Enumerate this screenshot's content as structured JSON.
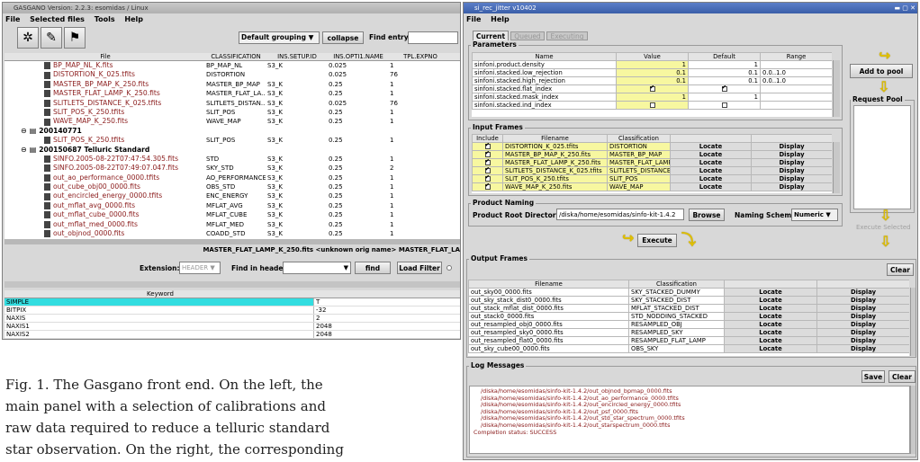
{
  "left": {
    "title": "GASGANO Version: 2.2.3: esomidas / Linux",
    "menu": [
      "File",
      "Selected files",
      "Tools",
      "Help"
    ],
    "grouping_value": "Default grouping",
    "collapse_label": "collapse",
    "find_entry_label": "Find entry:",
    "columns": [
      "File",
      "CLASSIFICATION",
      "INS.SETUP.ID",
      "INS.OPTI1.NAME",
      "TPL.EXPNO"
    ],
    "files": [
      {
        "name": "BP_MAP_NL_K.fits",
        "cls": "BP_MAP_NL",
        "setup": "S3_K",
        "opti": "0.025",
        "expno": "1",
        "kind": "red",
        "indent": 1
      },
      {
        "name": "DISTORTION_K_025.tfits",
        "cls": "DISTORTION",
        "setup": "",
        "opti": "0.025",
        "expno": "76",
        "kind": "red",
        "indent": 1
      },
      {
        "name": "MASTER_BP_MAP_K_250.fits",
        "cls": "MASTER_BP_MAP",
        "setup": "S3_K",
        "opti": "0.25",
        "expno": "1",
        "kind": "red",
        "indent": 1
      },
      {
        "name": "MASTER_FLAT_LAMP_K_250.fits",
        "cls": "MASTER_FLAT_LA...",
        "setup": "S3_K",
        "opti": "0.25",
        "expno": "1",
        "kind": "red",
        "indent": 1
      },
      {
        "name": "SLITLETS_DISTANCE_K_025.tfits",
        "cls": "SLITLETS_DISTAN...",
        "setup": "S3_K",
        "opti": "0.025",
        "expno": "76",
        "kind": "red",
        "indent": 1
      },
      {
        "name": "SLIT_POS_K_250.tfits",
        "cls": "SLIT_POS",
        "setup": "S3_K",
        "opti": "0.25",
        "expno": "1",
        "kind": "red",
        "indent": 1
      },
      {
        "name": "WAVE_MAP_K_250.fits",
        "cls": "WAVE_MAP",
        "setup": "S3_K",
        "opti": "0.25",
        "expno": "1",
        "kind": "red",
        "indent": 1
      },
      {
        "name": "200140771",
        "cls": "",
        "setup": "",
        "opti": "",
        "expno": "",
        "kind": "group",
        "indent": 0
      },
      {
        "name": "SLIT_POS_K_250.tfits",
        "cls": "SLIT_POS",
        "setup": "S3_K",
        "opti": "0.25",
        "expno": "1",
        "kind": "red",
        "indent": 1
      },
      {
        "name": "200150687    Telluric Standard",
        "cls": "",
        "setup": "",
        "opti": "",
        "expno": "",
        "kind": "group",
        "indent": 0
      },
      {
        "name": "SINFO.2005-08-22T07:47:54.305.fits",
        "cls": "STD",
        "setup": "S3_K",
        "opti": "0.25",
        "expno": "1",
        "kind": "red",
        "indent": 1
      },
      {
        "name": "SINFO.2005-08-22T07:49:07.047.fits",
        "cls": "SKY_STD",
        "setup": "S3_K",
        "opti": "0.25",
        "expno": "2",
        "kind": "red",
        "indent": 1
      },
      {
        "name": "out_ao_performance_0000.tfits",
        "cls": "AO_PERFORMANCE",
        "setup": "S3_K",
        "opti": "0.25",
        "expno": "1",
        "kind": "red",
        "indent": 1
      },
      {
        "name": "out_cube_obj00_0000.fits",
        "cls": "OBS_STD",
        "setup": "S3_K",
        "opti": "0.25",
        "expno": "1",
        "kind": "red",
        "indent": 1
      },
      {
        "name": "out_encircled_energy_0000.tfits",
        "cls": "ENC_ENERGY",
        "setup": "S3_K",
        "opti": "0.25",
        "expno": "1",
        "kind": "red",
        "indent": 1
      },
      {
        "name": "out_mflat_avg_0000.fits",
        "cls": "MFLAT_AVG",
        "setup": "S3_K",
        "opti": "0.25",
        "expno": "1",
        "kind": "red",
        "indent": 1
      },
      {
        "name": "out_mflat_cube_0000.fits",
        "cls": "MFLAT_CUBE",
        "setup": "S3_K",
        "opti": "0.25",
        "expno": "1",
        "kind": "red",
        "indent": 1
      },
      {
        "name": "out_mflat_med_0000.fits",
        "cls": "MFLAT_MED",
        "setup": "S3_K",
        "opti": "0.25",
        "expno": "1",
        "kind": "red",
        "indent": 1
      },
      {
        "name": "out_objnod_0000.fits",
        "cls": "COADD_STD",
        "setup": "S3_K",
        "opti": "0.25",
        "expno": "1",
        "kind": "red",
        "indent": 1
      }
    ],
    "status_line": "MASTER_FLAT_LAMP_K_250.fits    <unknown orig name>   MASTER_FLAT_LA",
    "extension_label": "Extension:",
    "extension_value": "HEADER",
    "find_header_label": "Find in header:",
    "find_button": "find",
    "load_filter": "Load Filter",
    "keyword_header": "Keyword",
    "keywords": [
      {
        "k": "SIMPLE",
        "v": "T"
      },
      {
        "k": "BITPIX",
        "v": "-32"
      },
      {
        "k": "NAXIS",
        "v": "2"
      },
      {
        "k": "NAXIS1",
        "v": "2048"
      },
      {
        "k": "NAXIS2",
        "v": "2048"
      }
    ]
  },
  "caption": {
    "lines": [
      "Fig. 1. The Gasgano front end. On the left, the",
      "main panel with a selection of calibrations and",
      "raw data required to reduce a telluric standard",
      "star observation. On the right, the corresponding"
    ]
  },
  "right": {
    "title": "si_rec_jitter v10402",
    "menu": [
      "File",
      "Help"
    ],
    "tabs": [
      "Current",
      "Queued",
      "Executing"
    ],
    "parameters_label": "Parameters",
    "param_columns": [
      "Name",
      "Value",
      "Default",
      "Range"
    ],
    "params": [
      {
        "name": "sinfoni.product.density",
        "value": "1",
        "default": "1",
        "range": "",
        "type": "num"
      },
      {
        "name": "sinfoni.stacked.low_rejection",
        "value": "0.1",
        "default": "0.1",
        "range": "0.0..1.0",
        "type": "num"
      },
      {
        "name": "sinfoni.stacked.high_rejection",
        "value": "0.1",
        "default": "0.1",
        "range": "0.0..1.0",
        "type": "num"
      },
      {
        "name": "sinfoni.stacked.flat_index",
        "value": "",
        "default": "",
        "range": "",
        "type": "check_on"
      },
      {
        "name": "sinfoni.stacked.mask_index",
        "value": "1",
        "default": "1",
        "range": "",
        "type": "num"
      },
      {
        "name": "sinfoni.stacked.ind_index",
        "value": "",
        "default": "",
        "range": "",
        "type": "check_off"
      }
    ],
    "add_to_pool": "Add to pool",
    "request_pool": "Request Pool",
    "execute_selected": "Execute Selected",
    "input_frames_label": "Input Frames",
    "input_columns": [
      "Include",
      "Filename",
      "Classification",
      "",
      ""
    ],
    "inputs": [
      {
        "file": "DISTORTION_K_025.tfits",
        "cls": "DISTORTION"
      },
      {
        "file": "MASTER_BP_MAP_K_250.fits",
        "cls": "MASTER_BP_MAP"
      },
      {
        "file": "MASTER_FLAT_LAMP_K_250.fits",
        "cls": "MASTER_FLAT_LAMP"
      },
      {
        "file": "SLITLETS_DISTANCE_K_025.tfits",
        "cls": "SLITLETS_DISTANCE"
      },
      {
        "file": "SLIT_POS_K_250.tfits",
        "cls": "SLIT_POS"
      },
      {
        "file": "WAVE_MAP_K_250.fits",
        "cls": "WAVE_MAP"
      }
    ],
    "locate_label": "Locate",
    "display_label": "Display",
    "product_naming_label": "Product Naming",
    "root_dir_label": "Product Root Directory:",
    "root_dir_value": "/diska/home/esomidas/sinfo-kit-1.4.2",
    "browse_label": "Browse",
    "naming_scheme_label": "Naming Scheme:",
    "naming_scheme_value": "Numeric",
    "execute_label": "Execute",
    "output_frames_label": "Output Frames",
    "clear_label": "Clear",
    "output_columns": [
      "Filename",
      "Classification",
      "",
      ""
    ],
    "outputs": [
      {
        "file": "out_sky00_0000.fits",
        "cls": "SKY_STACKED_DUMMY"
      },
      {
        "file": "out_sky_stack_dist0_0000.fits",
        "cls": "SKY_STACKED_DIST"
      },
      {
        "file": "out_stack_mflat_dist_0000.fits",
        "cls": "MFLAT_STACKED_DIST"
      },
      {
        "file": "out_stack0_0000.fits",
        "cls": "STD_NODDING_STACKED"
      },
      {
        "file": "out_resampled_obj0_0000.fits",
        "cls": "RESAMPLED_OBJ"
      },
      {
        "file": "out_resampled_sky0_0000.fits",
        "cls": "RESAMPLED_SKY"
      },
      {
        "file": "out_resampled_flat0_0000.fits",
        "cls": "RESAMPLED_FLAT_LAMP"
      },
      {
        "file": "out_sky_cube00_0000.fits",
        "cls": "OBS_SKY"
      }
    ],
    "log_label": "Log Messages",
    "save_label": "Save",
    "log_lines": [
      "/diska/home/esomidas/sinfo-kit-1.4.2/out_objnod_bpmap_0000.fits",
      "/diska/home/esomidas/sinfo-kit-1.4.2/out_ao_performance_0000.tfits",
      "/diska/home/esomidas/sinfo-kit-1.4.2/out_encircled_energy_0000.tfits",
      "/diska/home/esomidas/sinfo-kit-1.4.2/out_psf_0000.fits",
      "/diska/home/esomidas/sinfo-kit-1.4.2/out_std_star_spectrum_0000.tfits",
      "/diska/home/esomidas/sinfo-kit-1.4.2/out_starspectrum_0000.tfits"
    ],
    "log_status": "Completion status: SUCCESS"
  }
}
